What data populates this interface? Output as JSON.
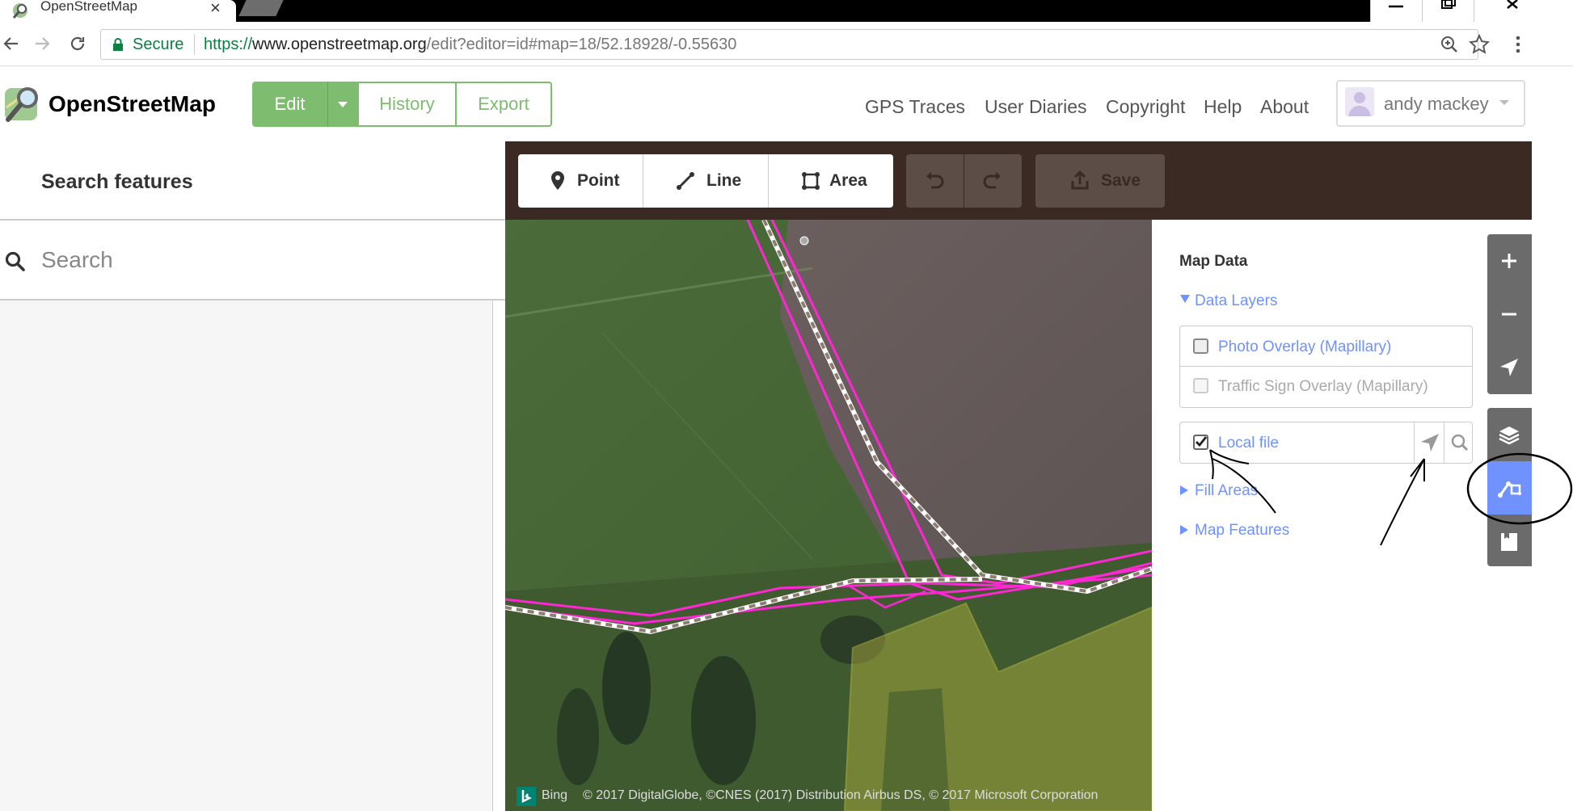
{
  "browser": {
    "tab_title": "OpenStreetMap",
    "tab_close": "×",
    "secure_label": "Secure",
    "url_scheme": "https://",
    "url_host": "www.openstreetmap.org",
    "url_path": "/edit?editor=id#map=18/52.18928/-0.55630"
  },
  "header": {
    "logo_text": "OpenStreetMap",
    "edit_label": "Edit",
    "history_label": "History",
    "export_label": "Export",
    "nav": [
      "GPS Traces",
      "User Diaries",
      "Copyright",
      "Help",
      "About"
    ],
    "user_name": "andy mackey"
  },
  "sidebar": {
    "title": "Search features",
    "search_placeholder": "Search"
  },
  "toolbar": {
    "point_label": "Point",
    "line_label": "Line",
    "area_label": "Area",
    "save_label": "Save"
  },
  "map_data": {
    "title": "Map Data",
    "data_layers_label": "Data Layers",
    "layers": [
      {
        "label": "Photo Overlay (Mapillary)",
        "checked": false,
        "enabled": true
      },
      {
        "label": "Traffic Sign Overlay (Mapillary)",
        "checked": false,
        "enabled": false
      }
    ],
    "local_file_label": "Local file",
    "local_file_checked": true,
    "fill_areas_label": "Fill Areas",
    "map_features_label": "Map Features"
  },
  "attribution": {
    "bing_label": "Bing",
    "text": "© 2017 DigitalGlobe, ©CNES (2017) Distribution Airbus DS, © 2017 Microsoft Corporation"
  },
  "colors": {
    "osm_green": "#7ebc6f",
    "link_blue": "#7092ff",
    "gpx_magenta": "#ff26d4",
    "active_control": "#7092ff"
  }
}
